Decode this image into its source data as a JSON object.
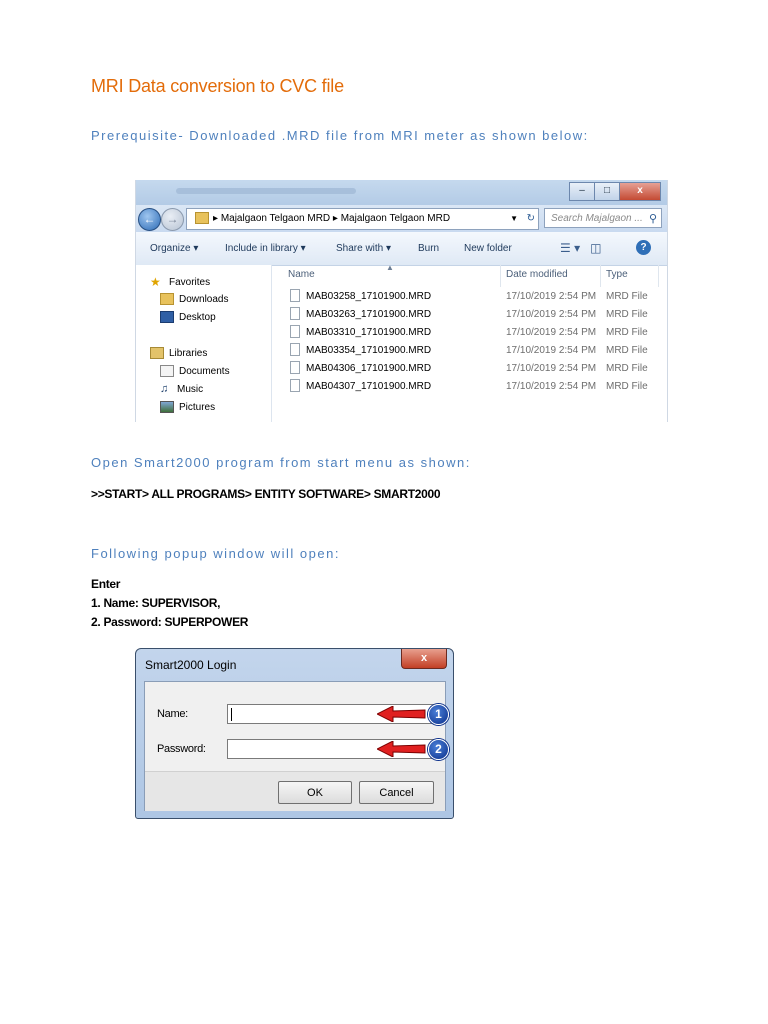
{
  "doc": {
    "title": "MRI Data conversion to CVC file",
    "prereq": "Prerequisite- Downloaded .MRD file from MRI meter as shown below:",
    "open_heading": "Open Smart2000 program from start menu as shown:",
    "start_path": ">>START> ALL PROGRAMS> ENTITY SOFTWARE> SMART2000",
    "popup_heading": "Following popup window will open:",
    "enter_label": "Enter",
    "step1": "1. Name: SUPERVISOR,",
    "step2": "2. Password: SUPERPOWER"
  },
  "explorer": {
    "breadcrumb1": "Majalgaon Telgaon MRD",
    "breadcrumb2": "Majalgaon Telgaon MRD",
    "search_placeholder": "Search Majalgaon ...",
    "toolbar": {
      "organize": "Organize",
      "include": "Include in library",
      "share": "Share with",
      "burn": "Burn",
      "new_folder": "New folder"
    },
    "nav": {
      "favorites": "Favorites",
      "downloads": "Downloads",
      "desktop": "Desktop",
      "libraries": "Libraries",
      "documents": "Documents",
      "music": "Music",
      "pictures": "Pictures"
    },
    "columns": {
      "name": "Name",
      "date": "Date modified",
      "type": "Type"
    },
    "files": [
      {
        "name": "MAB03258_17101900.MRD",
        "date": "17/10/2019 2:54 PM",
        "type": "MRD File"
      },
      {
        "name": "MAB03263_17101900.MRD",
        "date": "17/10/2019 2:54 PM",
        "type": "MRD File"
      },
      {
        "name": "MAB03310_17101900.MRD",
        "date": "17/10/2019 2:54 PM",
        "type": "MRD File"
      },
      {
        "name": "MAB03354_17101900.MRD",
        "date": "17/10/2019 2:54 PM",
        "type": "MRD File"
      },
      {
        "name": "MAB04306_17101900.MRD",
        "date": "17/10/2019 2:54 PM",
        "type": "MRD File"
      },
      {
        "name": "MAB04307_17101900.MRD",
        "date": "17/10/2019 2:54 PM",
        "type": "MRD File"
      }
    ]
  },
  "login": {
    "title": "Smart2000  Login",
    "close": "x",
    "name_label": "Name:",
    "password_label": "Password:",
    "ok": "OK",
    "cancel": "Cancel",
    "badge1": "1",
    "badge2": "2"
  },
  "icons": {
    "back": "arrow-left-icon",
    "forward": "arrow-right-icon",
    "search": "magnifier-icon",
    "help": "help-icon"
  }
}
